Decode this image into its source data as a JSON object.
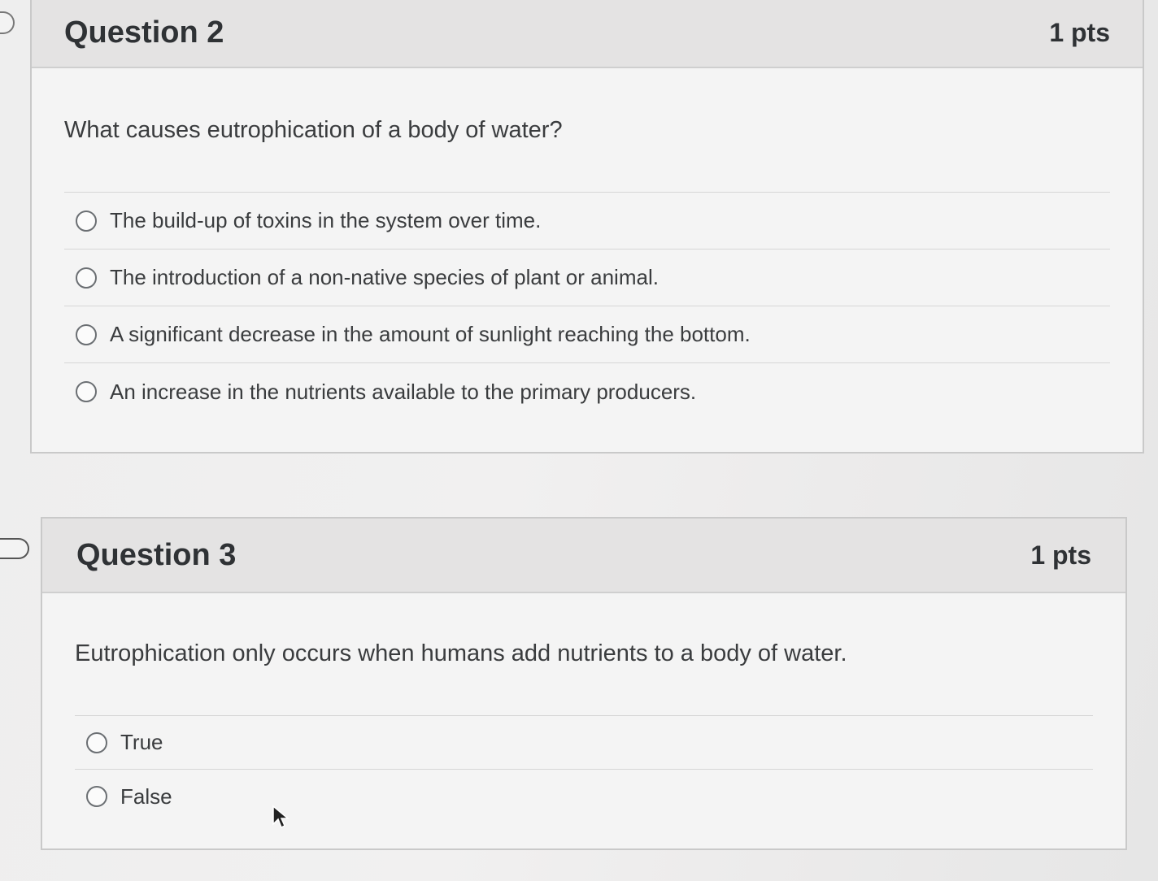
{
  "questions": [
    {
      "title": "Question 2",
      "points": "1 pts",
      "text": "What causes eutrophication of a body of water?",
      "answers": [
        "The build-up of toxins in the system over time.",
        "The introduction of a non-native species of plant or animal.",
        "A significant decrease in the amount of sunlight reaching the bottom.",
        "An increase in the nutrients available to the primary producers."
      ]
    },
    {
      "title": "Question 3",
      "points": "1 pts",
      "text": "Eutrophication only occurs when humans add nutrients to a body of water.",
      "answers": [
        "True",
        "False"
      ]
    }
  ],
  "icons": {
    "flag": "flag-question-icon",
    "radio": "radio-button-icon",
    "cursor": "mouse-pointer-icon"
  }
}
